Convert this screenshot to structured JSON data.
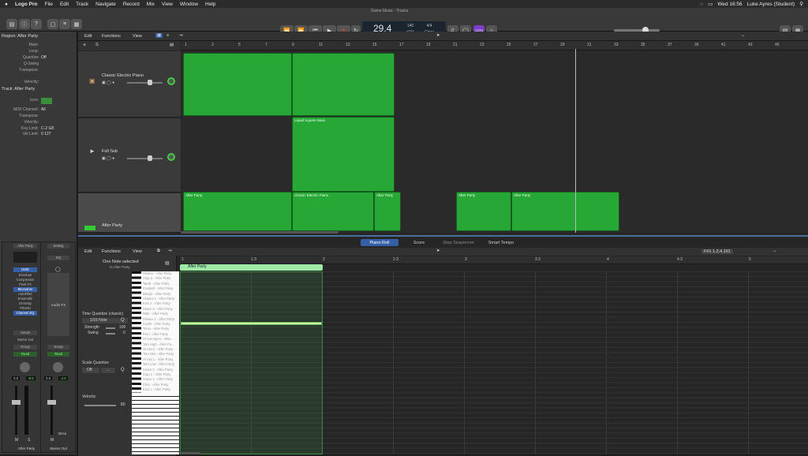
{
  "menubar": {
    "apple": "",
    "items": [
      "Logo Pro",
      "File",
      "Edit",
      "Track",
      "Navigate",
      "Record",
      "Mix",
      "View",
      "Window",
      "Help"
    ],
    "clock": "Wed 16:56",
    "user": "Luke Ayres (Student)"
  },
  "window": {
    "title": "Game Music - Tracks"
  },
  "lcd": {
    "bar": "29.4",
    "tempo": "140",
    "tempo_label": "KEEP",
    "sig": "4/4",
    "key": "Cmaj"
  },
  "count_in": "1234",
  "inspector": {
    "region_header": "Region: After Party",
    "region_rows": [
      [
        "Mute:",
        ""
      ],
      [
        "Loop:",
        ""
      ],
      [
        "Quantize",
        "Off"
      ],
      [
        "Q-Swing",
        ""
      ],
      [
        "Transpose:",
        ""
      ],
      [
        "Velocity:",
        ""
      ]
    ],
    "track_header": "Track: After Party",
    "track_rows": [
      [
        "Icon:",
        ""
      ],
      [
        "MIDI Channel:",
        "All"
      ],
      [
        "Transpose:",
        ""
      ],
      [
        "Velocity:",
        ""
      ],
      [
        "Key Limit:",
        "C-2  G8"
      ],
      [
        "Vel Limit:",
        "0  127"
      ]
    ]
  },
  "tracks_menu": {
    "edit": "Edit",
    "functions": "Functions",
    "view": "View"
  },
  "ruler_bars": [
    "1",
    "3",
    "5",
    "7",
    "9",
    "11",
    "13",
    "15",
    "17",
    "19",
    "21",
    "23",
    "25",
    "27",
    "29",
    "31",
    "33",
    "35",
    "37",
    "39",
    "41",
    "43",
    "45"
  ],
  "track_list": [
    {
      "name": "Classic Electric Piano"
    },
    {
      "name": "Full Sub"
    },
    {
      "name": "After Party"
    }
  ],
  "regions": [
    {
      "label": ""
    },
    {
      "label": ""
    },
    {
      "label": "Liquid Square Bass"
    },
    {
      "label": "After Party"
    },
    {
      "label": "Classic Electric Piano"
    },
    {
      "label": "After Party"
    },
    {
      "label": "After Party"
    },
    {
      "label": "After Party"
    }
  ],
  "editor": {
    "tabs": [
      "Piano Roll",
      "Score",
      "Step Sequencer",
      "Smart Tempo"
    ],
    "menu": {
      "edit": "Edit",
      "functions": "Functions",
      "view": "View"
    },
    "selection": "One Note selected",
    "selection_sub": "in After Party",
    "position": "F#1  1.2.4.161",
    "ruler": [
      "1",
      "1.3",
      "2",
      "2.3",
      "3",
      "3.3",
      "4",
      "4.3",
      "5"
    ],
    "region_label": "After Party",
    "time_quantize": "Time Quantize (classic)",
    "tq_value": "1/16 Note",
    "strength_label": "Strength",
    "strength": "100",
    "swing_label": "Swing",
    "swing": "0",
    "scale_quantize": "Scale Quantize",
    "sq_value": "Off",
    "velocity_label": "Velocity",
    "velocity": "80",
    "drum_keys": [
      "Shaker - After Party",
      "Clap 2 - After Party",
      "Tamb - After Party",
      "Cowbell - After Party",
      "Bongo - After Party",
      "Shaker 1 - After Party",
      "Kick 2 - After Party",
      "Snare 3 - After Party",
      "Ride - After Party",
      "Shaker 2 - After Party",
      "Crash - After Party",
      "Toms - After Party",
      "Perc - After Party",
      "Hi Hat Open - After...",
      "Tom High - After Pa...",
      "Hi Hat 3 - After Party",
      "Tom Mid - After Party",
      "Hi Hat 1 - After Party",
      "Tom Low - After Party",
      "Snare 2 - After Party",
      "Clap 1 - After Party",
      "Snare 1 - After Party",
      "Click - After Party",
      "Kick 1 - After Party"
    ]
  },
  "channel_strips": [
    {
      "name": "After Party",
      "setting": "After Party",
      "plugins": [
        "DMD",
        "Envelopr",
        "Compressor",
        "Pixel FX",
        "Bitcrusher",
        "AutoFilter",
        "Ensemble",
        "St-Delay",
        "PitVerb",
        "Channel EQ"
      ],
      "sends": "Sends",
      "output": "Stereo Out",
      "group": "Group",
      "automation": "Read",
      "vol": "0.0",
      "pan": "-8.6",
      "mute": "M",
      "solo": "S"
    },
    {
      "name": "Stereo Out",
      "setting": "Setting",
      "plugins": [
        "EQ",
        "Audio FX"
      ],
      "group": "Group",
      "automation": "Read",
      "vol": "0.0",
      "pan": "-4.6",
      "mute": "M",
      "bounce": "Bnce"
    }
  ]
}
